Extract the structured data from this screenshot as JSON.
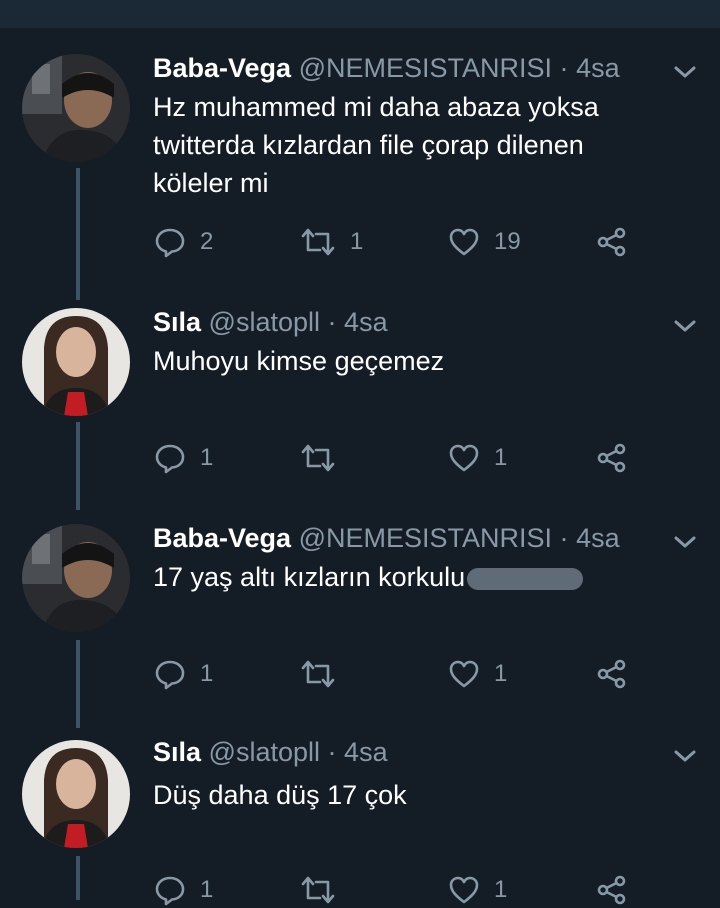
{
  "colors": {
    "background": "#141d26",
    "text_primary": "#ffffff",
    "text_secondary": "#8899a6",
    "thread_line": "#3d5466"
  },
  "tweets": [
    {
      "name": "Baba-Vega",
      "handle": "@NEMESISTANRISI",
      "separator": "·",
      "time": "4sa",
      "text_lines": [
        "Hz muhammed mi daha abaza yoksa",
        "twitterda kızlardan file çorap dilenen",
        "köleler mi"
      ],
      "reply_count": "2",
      "retweet_count": "1",
      "like_count": "19"
    },
    {
      "name": "Sıla",
      "handle": "@slatopll",
      "separator": "·",
      "time": "4sa",
      "text_lines": [
        "Muhoyu kimse geçemez"
      ],
      "reply_count": "1",
      "retweet_count": "",
      "like_count": "1"
    },
    {
      "name": "Baba-Vega",
      "handle": "@NEMESISTANRISI",
      "separator": "·",
      "time": "4sa",
      "text_lines": [
        "17 yaş altı kızların korkulu"
      ],
      "reply_count": "1",
      "retweet_count": "",
      "like_count": "1"
    },
    {
      "name": "Sıla",
      "handle": "@slatopll",
      "separator": "·",
      "time": "4sa",
      "text_lines": [
        "Düş daha düş 17 çok"
      ],
      "reply_count": "1",
      "retweet_count": "",
      "like_count": "1"
    }
  ],
  "icons": {
    "reply": "reply-icon",
    "retweet": "retweet-icon",
    "like": "heart-icon",
    "share": "share-icon",
    "menu": "chevron-down-icon"
  }
}
